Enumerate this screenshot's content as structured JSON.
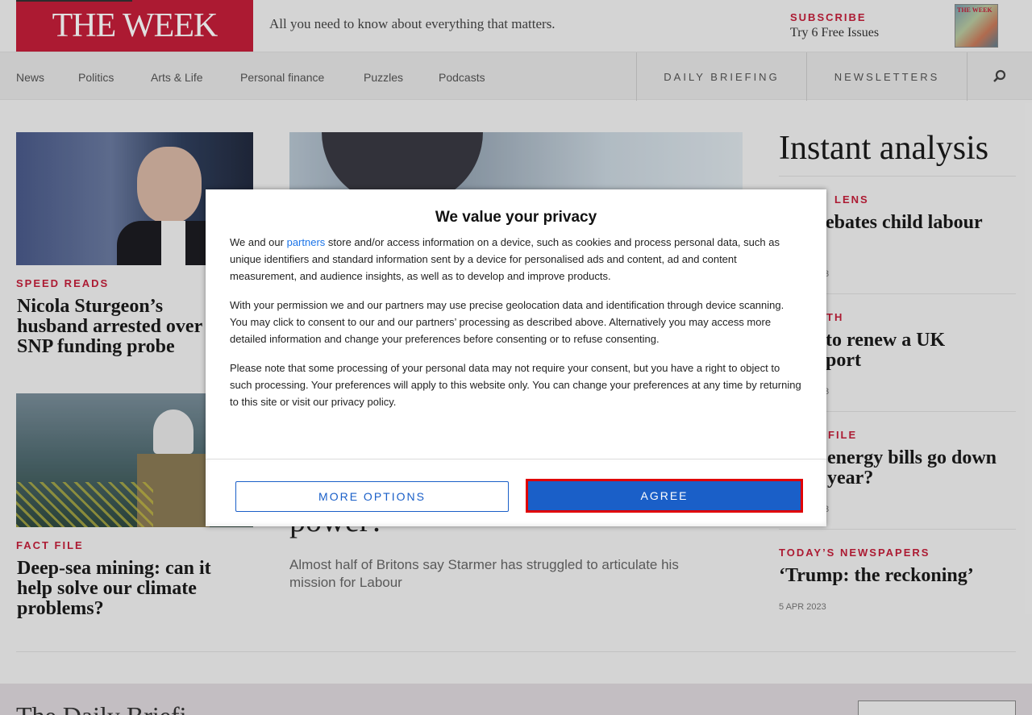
{
  "header": {
    "logo": "THE WEEK",
    "tagline": "All you need to know about everything that matters.",
    "subscribe_kicker": "SUBSCRIBE",
    "subscribe_text": "Try 6 Free Issues",
    "magazine_logo": "THE WEEK"
  },
  "nav": {
    "items": [
      "News",
      "Politics",
      "Arts & Life",
      "Personal finance",
      "Puzzles",
      "Podcasts"
    ],
    "daily_briefing": "DAILY BRIEFING",
    "newsletters": "NEWSLETTERS"
  },
  "articles": {
    "left": [
      {
        "kicker": "SPEED READS",
        "headline": "Nicola Sturgeon’s husband arrested over SNP funding probe"
      },
      {
        "kicker": "FACT FILE",
        "headline": "Deep-sea mining: can it help solve our climate problems?"
      }
    ],
    "lead": {
      "headline_tail": "power?",
      "standfirst": "Almost half of Britons say Starmer has struggled to articulate his mission for Labour"
    },
    "instant_analysis": {
      "title": "Instant analysis",
      "items": [
        {
          "kicker": "LENS",
          "headline": "ebates child labour",
          "date": "3"
        },
        {
          "kicker": "TH",
          "headline": "to renew a UK\nport",
          "date": "3"
        },
        {
          "kicker": "FILE",
          "headline": "energy bills go down\nyear?",
          "date": "3"
        },
        {
          "kicker": "TODAY’S NEWSPAPERS",
          "headline": "‘Trump: the reckoning’",
          "date": "5 APR 2023"
        }
      ]
    }
  },
  "footer": {
    "title": "The Daily Briefi"
  },
  "consent": {
    "title": "We value your privacy",
    "p1_before": "We and our ",
    "p1_link": "partners",
    "p1_after": " store and/or access information on a device, such as cookies and process personal data, such as unique identifiers and standard information sent by a device for personalised ads and content, ad and content measurement, and audience insights, as well as to develop and improve products.",
    "p2": "With your permission we and our partners may use precise geolocation data and identification through device scanning. You may click to consent to our and our partners’ processing as described above. Alternatively you may access more detailed information and change your preferences before consenting or to refuse consenting.",
    "p3": "Please note that some processing of your personal data may not require your consent, but you have a right to object to such processing. Your preferences will apply to this website only. You can change your preferences at any time by returning to this site or visit our privacy policy.",
    "more_options": "MORE OPTIONS",
    "agree": "AGREE"
  }
}
